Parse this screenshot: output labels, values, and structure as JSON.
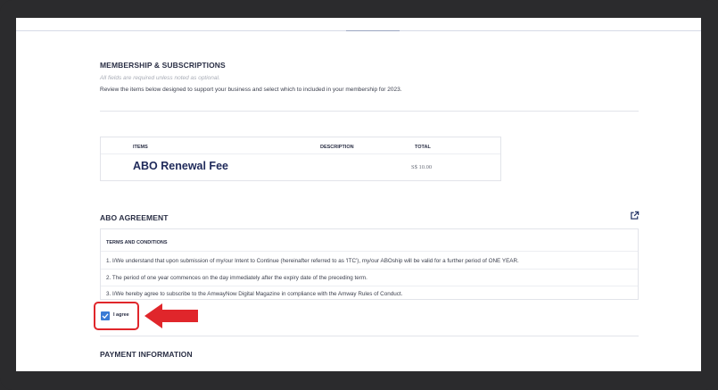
{
  "membership": {
    "title": "MEMBERSHIP & SUBSCRIPTIONS",
    "note": "All fields are required unless noted as optional.",
    "description": "Review the items below designed to support your business and select which to included in your membership for 2023."
  },
  "items_table": {
    "columns": [
      "ITEMS",
      "DESCRIPTION",
      "TOTAL"
    ],
    "rows": [
      {
        "item": "ABO Renewal Fee",
        "description": "",
        "total": "S$ 10.00"
      }
    ]
  },
  "agreement": {
    "title": "ABO AGREEMENT",
    "terms_title": "TERMS AND CONDITIONS",
    "terms": [
      "1. I/We understand that upon submission of my/our Intent to Continue (hereinafter referred to as 'ITC'), my/our ABOship will be valid for a further period of ONE YEAR.",
      "2. The period of one year commences on the day immediately after the expiry date of the preceding term.",
      "3. I/We hereby agree to subscribe to the AmwayNow Digital Magazine in compliance with the Amway Rules of Conduct."
    ],
    "agree_label": "I agree",
    "agree_checked": true
  },
  "payment": {
    "title": "PAYMENT INFORMATION"
  },
  "icons": {
    "external": "external-link-icon",
    "check": "check-icon",
    "arrow": "red-arrow-icon"
  },
  "colors": {
    "highlight": "#e0262b",
    "checkbox": "#3a7bd5",
    "heading": "#1f2a5a"
  }
}
